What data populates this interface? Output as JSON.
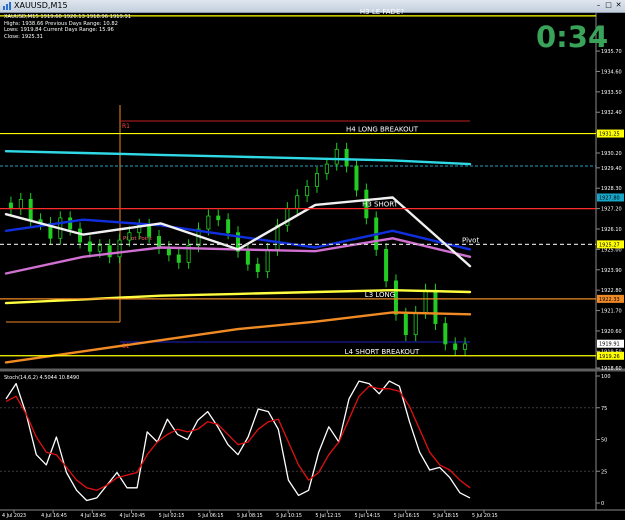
{
  "window": {
    "title": "XAUUSD,M15"
  },
  "header": {
    "symbol_line": "XAUUSD,M15   1919.60  1920.13  1918.96  1919.91",
    "info": [
      "Highs: 1938.66     Previous Days Range: 10.82",
      "Lows: 1919.84     Current Days Range: 15.96",
      "Close: 1925.31"
    ]
  },
  "timer": "0:34",
  "chart_data": [
    {
      "type": "line",
      "title": "XAUUSD,M15",
      "ylim": [
        1918.6,
        1937.7
      ],
      "y_ticks": [
        "1935.70",
        "1934.60",
        "1933.50",
        "1932.40",
        "1931.30",
        "1930.20",
        "1929.40",
        "1928.30",
        "1927.20",
        "1926.10",
        "1925.00",
        "1923.90",
        "1922.80",
        "1921.70",
        "1920.60",
        "1919.50",
        "1918.60"
      ],
      "price_labels": [
        {
          "value": 1931.25,
          "text": "1931.25",
          "color": "#ffff00"
        },
        {
          "value": 1927.8,
          "text": "1927.80",
          "color": "#17a6c8"
        },
        {
          "value": 1925.27,
          "text": "1925.27",
          "color": "#ffff00"
        },
        {
          "value": 1922.33,
          "text": "1922.33",
          "color": "#f08a24"
        },
        {
          "value": 1919.91,
          "text": "1919.91",
          "color": "#ffffff"
        },
        {
          "value": 1919.26,
          "text": "1919.26",
          "color": "#ffff00"
        }
      ],
      "levels": [
        {
          "name": "H3 LE FADE?",
          "value": 1937.6,
          "color": "#ffff00"
        },
        {
          "name": "H4 LONG BREAKOUT",
          "value": 1931.25,
          "color": "#ffff00"
        },
        {
          "name": "H3 SHORT",
          "value": 1927.2,
          "color": "#ff2b2b"
        },
        {
          "name": "Pivot",
          "value": 1925.27,
          "color": "#d0d0d0"
        },
        {
          "name": "L3 LONG",
          "value": 1922.33,
          "color": "#f08a24"
        },
        {
          "name": "L4 SHORT BREAKOUT",
          "value": 1919.26,
          "color": "#ffff00"
        }
      ],
      "annotations": [
        "R1",
        "S1",
        "Pivot Point",
        "Pivot"
      ],
      "series": [
        {
          "color": "#30d9e6",
          "values": [
            1930.3,
            1930.2,
            1930.1,
            1930.0,
            1929.9,
            1929.8,
            1929.6
          ]
        },
        {
          "color": "#1030e0",
          "values": [
            1926.0,
            1926.6,
            1926.3,
            1925.7,
            1925.1,
            1926.0,
            1925.0
          ]
        },
        {
          "color": "#d070d0",
          "values": [
            1923.7,
            1924.6,
            1925.1,
            1925.0,
            1924.9,
            1925.6,
            1924.6
          ]
        },
        {
          "color": "#ffff40",
          "values": [
            1922.1,
            1922.3,
            1922.5,
            1922.6,
            1922.7,
            1922.8,
            1922.7
          ]
        },
        {
          "color": "#f08a24",
          "values": [
            1918.9,
            1919.5,
            1920.1,
            1920.7,
            1921.1,
            1921.6,
            1921.5
          ]
        },
        {
          "color": "#f0f0f0",
          "values": [
            1926.9,
            1925.8,
            1926.4,
            1925.0,
            1927.4,
            1927.8,
            1924.1
          ]
        }
      ],
      "candles": [
        1927.2,
        1927.7,
        1926.6,
        1926.4,
        1925.6,
        1926.7,
        1926.1,
        1925.4,
        1924.9,
        1925.2,
        1924.6,
        1925.5,
        1925.9,
        1926.3,
        1925.7,
        1925.1,
        1924.7,
        1924.3,
        1925.2,
        1926.1,
        1926.8,
        1926.6,
        1925.9,
        1924.9,
        1924.2,
        1923.8,
        1925.0,
        1926.3,
        1927.2,
        1927.9,
        1928.4,
        1929.1,
        1929.6,
        1930.4,
        1929.5,
        1928.2,
        1926.7,
        1925.0,
        1923.3,
        1921.5,
        1920.4,
        1921.6,
        1922.8,
        1921.0,
        1919.9,
        1919.6,
        1919.9
      ]
    },
    {
      "type": "line",
      "title": "Stoch(14,6,2) 4.5044 10.8490",
      "ylim": [
        0,
        100
      ],
      "y_ticks": [
        "100",
        "75",
        "50",
        "25",
        "0"
      ],
      "x_ticks": [
        "4 Jul 2023",
        "4 Jul 16:45",
        "4 Jul 18:45",
        "4 Jul 20:45",
        "5 Jul 02:15",
        "5 Jul 06:15",
        "5 Jul 08:15",
        "5 Jul 10:15",
        "5 Jul 12:15",
        "5 Jul 14:15",
        "5 Jul 16:15",
        "5 Jul 18:15",
        "5 Jul 20:15"
      ],
      "series": [
        {
          "name": "Stoch main",
          "color": "#ffffff",
          "values": [
            82,
            94,
            70,
            38,
            30,
            52,
            24,
            10,
            2,
            4,
            14,
            24,
            12,
            12,
            56,
            48,
            66,
            54,
            50,
            65,
            72,
            60,
            46,
            38,
            52,
            74,
            72,
            58,
            18,
            6,
            10,
            40,
            60,
            48,
            82,
            96,
            94,
            86,
            96,
            92,
            64,
            40,
            26,
            28,
            20,
            8,
            4
          ]
        },
        {
          "name": "Stoch signal",
          "color": "#e01010",
          "values": [
            80,
            84,
            70,
            52,
            40,
            38,
            28,
            18,
            12,
            10,
            14,
            20,
            22,
            24,
            38,
            48,
            54,
            58,
            56,
            58,
            64,
            62,
            54,
            46,
            48,
            58,
            64,
            66,
            48,
            30,
            18,
            24,
            38,
            48,
            66,
            84,
            92,
            90,
            90,
            88,
            76,
            58,
            40,
            30,
            26,
            18,
            12
          ]
        }
      ]
    }
  ]
}
